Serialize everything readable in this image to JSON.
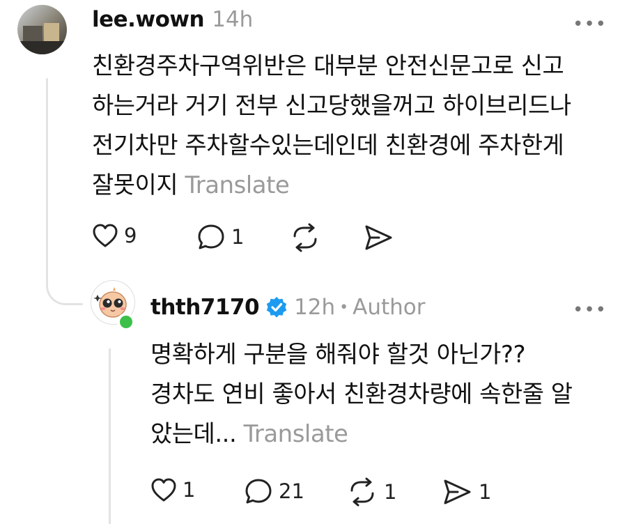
{
  "comment1": {
    "username": "lee.wown",
    "time": "14h",
    "lines": [
      "친환경주차구역위반은 대부분 안전신문고로 신고",
      "하는거라 거기 전부 신고당했을꺼고 하이브리드나",
      "전기차만  주차할수있는데인데  친환경에 주차한게",
      "잘못이지"
    ],
    "translate": "Translate",
    "likes": "9",
    "replies": "1"
  },
  "comment2": {
    "username": "thth7170",
    "time": "12h",
    "separator": "•",
    "author": "Author",
    "lines": [
      "명확하게 구분을 해줘야 할것 아닌가??",
      "경차도 연비 좋아서 친환경차량에 속한줄 알",
      "았는데..."
    ],
    "translate": "Translate",
    "likes": "1",
    "replies": "21",
    "reposts": "1",
    "shares": "1"
  },
  "colors": {
    "verified": "#1d9bf0",
    "online": "#3cc04a",
    "muted": "#9a9a9a"
  },
  "icons": [
    "heart-icon",
    "comment-icon",
    "repost-icon",
    "share-icon",
    "more-icon",
    "verified-icon"
  ]
}
